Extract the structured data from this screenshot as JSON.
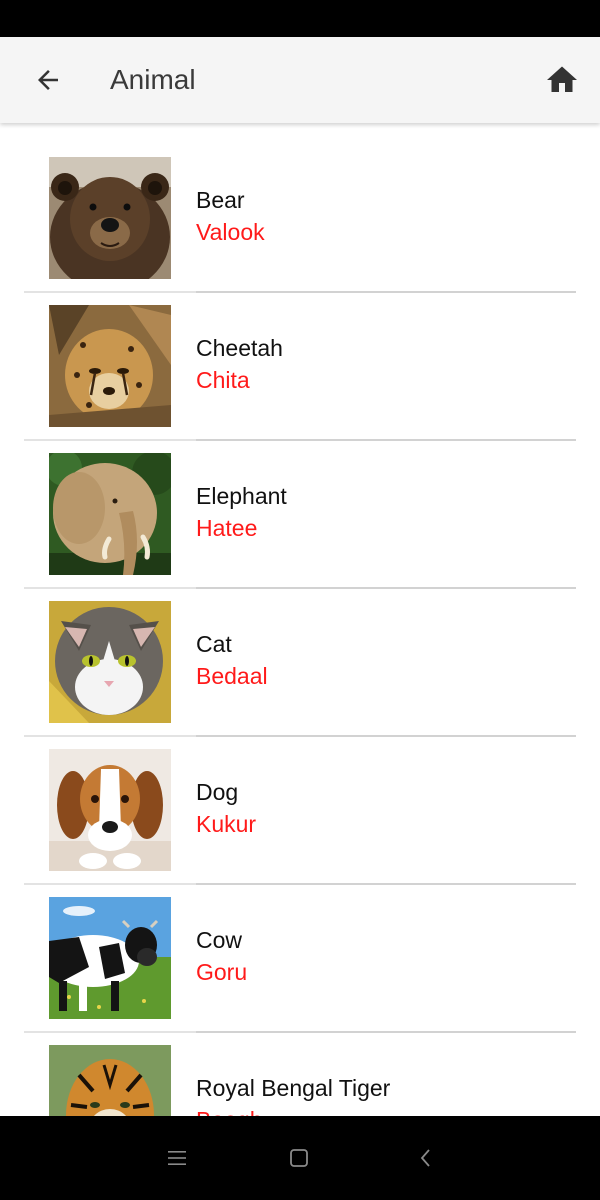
{
  "app_bar": {
    "title": "Animal",
    "back_icon": "arrow-left-icon",
    "home_icon": "home-icon",
    "background": "#f5f5f5"
  },
  "animals": [
    {
      "name": "Bear",
      "local_name": "Valook",
      "image": "bear-photo"
    },
    {
      "name": "Cheetah",
      "local_name": "Chita",
      "image": "cheetah-photo"
    },
    {
      "name": "Elephant",
      "local_name": "Hatee",
      "image": "elephant-photo"
    },
    {
      "name": "Cat",
      "local_name": "Bedaal",
      "image": "cat-photo"
    },
    {
      "name": "Dog",
      "local_name": "Kukur",
      "image": "dog-photo"
    },
    {
      "name": "Cow",
      "local_name": "Goru",
      "image": "cow-photo"
    },
    {
      "name": "Royal Bengal Tiger",
      "local_name": "Baagh",
      "image": "tiger-photo"
    }
  ],
  "colors": {
    "name_text": "#111111",
    "local_name_text": "#ff1a1a",
    "divider": "#d2d2d2"
  },
  "nav_bar": {
    "menu_icon": "menu-icon",
    "home_icon": "square-home-icon",
    "back_icon": "chevron-left-icon"
  }
}
